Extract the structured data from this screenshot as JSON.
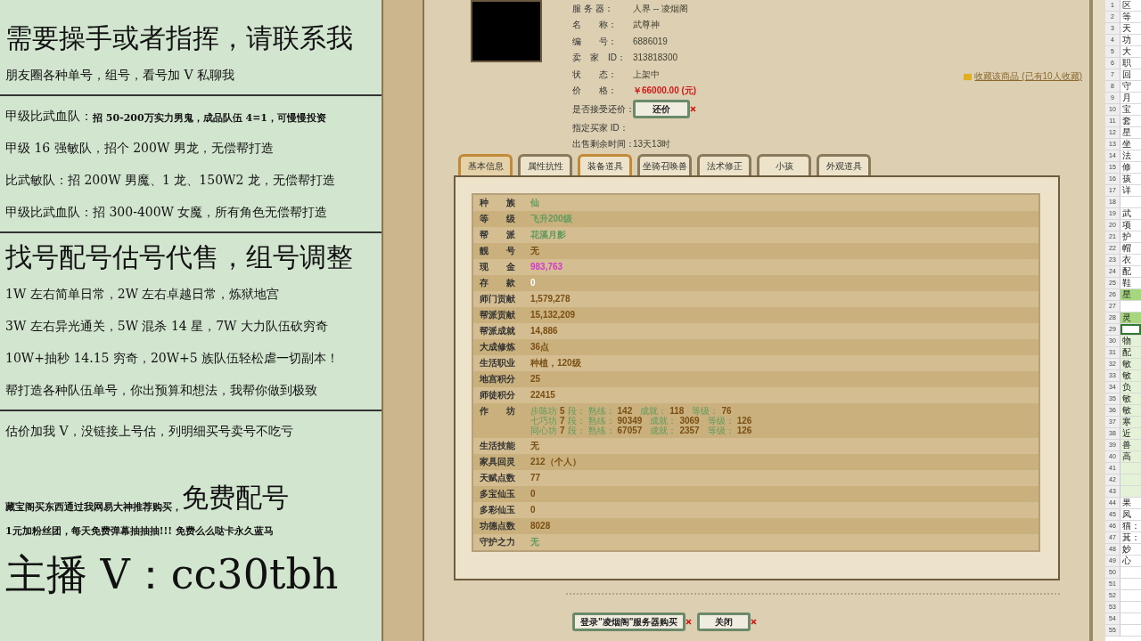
{
  "ad_panel": [
    {
      "kind": "text",
      "parts": [
        {
          "text": "需要操手或者指挥，请联系我",
          "kind": "xl"
        }
      ]
    },
    {
      "kind": "text",
      "parts": [
        {
          "text": "朋友圈各种单号，组号，看号加 V 私聊我",
          "kind": "md"
        }
      ]
    },
    {
      "kind": "divider"
    },
    {
      "kind": "text",
      "parts": [
        {
          "text": "甲级比武血队：",
          "kind": "md"
        },
        {
          "text": "招 50-200万实力男鬼，成品队伍 4=1，可慢慢投资",
          "kind": "sm"
        }
      ]
    },
    {
      "kind": "text",
      "parts": [
        {
          "text": "甲级 16 强敏队，招个 200W 男龙，无偿帮打造",
          "kind": "md"
        }
      ]
    },
    {
      "kind": "text",
      "parts": [
        {
          "text": "比武敏队：招 200W 男魔、1 龙、150W2 龙，无偿帮打造",
          "kind": "md"
        }
      ]
    },
    {
      "kind": "text",
      "parts": [
        {
          "text": "甲级比武血队：招 300-400W 女魔，所有角色无偿帮打造",
          "kind": "md"
        }
      ]
    },
    {
      "kind": "divider"
    },
    {
      "kind": "text",
      "parts": [
        {
          "text": "找号配号估号代售，组号调整",
          "kind": "xl"
        }
      ]
    },
    {
      "kind": "text",
      "parts": [
        {
          "text": "1W 左右简单日常，2W 左右卓越日常，炼狱地宫",
          "kind": "md"
        }
      ]
    },
    {
      "kind": "text",
      "parts": [
        {
          "text": "3W 左右异光通关，5W 混杀 14 星，7W 大力队伍砍穷奇",
          "kind": "md"
        }
      ]
    },
    {
      "kind": "text",
      "parts": [
        {
          "text": "10W+抽秒 14.15 穷奇，20W+5 族队伍轻松虐一切副本！",
          "kind": "md"
        }
      ]
    },
    {
      "kind": "text",
      "parts": [
        {
          "text": "帮打造各种队伍单号，你出预算和想法，我帮你做到极致",
          "kind": "md"
        }
      ]
    },
    {
      "kind": "divider"
    },
    {
      "kind": "text",
      "parts": [
        {
          "text": "估价加我 V，没链接上号估，列明细买号卖号不吃亏",
          "kind": "md"
        }
      ]
    },
    {
      "kind": "spacer"
    },
    {
      "kind": "text",
      "parts": [
        {
          "text": "藏宝阁买东西通过我网易大神推荐购买，",
          "kind": "sm"
        },
        {
          "text": "免费配号",
          "kind": "xl"
        }
      ]
    },
    {
      "kind": "text",
      "parts": [
        {
          "text": "1元加粉丝团，每天免费弹幕抽抽抽!!! 免费么么哒卡永久蓝马",
          "kind": "sm"
        }
      ]
    },
    {
      "kind": "text",
      "parts": [
        {
          "text": "主播 V：cc30tbh",
          "kind": "xxl"
        }
      ]
    }
  ],
  "listing": {
    "favorite_link": "收藏该商品 (已有10人收藏)",
    "info": [
      {
        "label": "服 务 器：",
        "value": "人界 -- 凌烟阁",
        "kind": "text"
      },
      {
        "label": "名　　称：",
        "value": "武尊神",
        "kind": "text"
      },
      {
        "label": "编　　号：",
        "value": "6886019",
        "kind": "text"
      },
      {
        "label": "卖　家　ID：",
        "value": "313818300",
        "kind": "text"
      },
      {
        "label": "状　　态：",
        "value": "上架中",
        "kind": "text"
      },
      {
        "label": "价　　格：",
        "value": "￥66000.00 (元)",
        "kind": "price"
      },
      {
        "label": "是否接受还价：",
        "value": "还价",
        "kind": "button"
      },
      {
        "label": "指定买家 ID：",
        "kind": "text"
      },
      {
        "label": "出售剩余时间：",
        "value": "13天13时",
        "kind": "text"
      }
    ],
    "tabs": [
      {
        "label": "基本信息",
        "selected": true,
        "hovered": false
      },
      {
        "label": "属性抗性",
        "selected": false,
        "hovered": false
      },
      {
        "label": "装备道具",
        "selected": false,
        "hovered": true
      },
      {
        "label": "坐骑召唤兽",
        "selected": false,
        "hovered": false
      },
      {
        "label": "法术修正",
        "selected": false,
        "hovered": false
      },
      {
        "label": "小孩",
        "selected": false,
        "hovered": false
      },
      {
        "label": "外观道具",
        "selected": false,
        "hovered": false
      }
    ],
    "rows": [
      {
        "label": "种　　族",
        "value": "仙",
        "color": "#5f9a5f"
      },
      {
        "label": "等　　级",
        "value": "飞升200级",
        "color": "#5f9a5f"
      },
      {
        "label": "帮　　派",
        "value": "花溪月影",
        "color": "#5f9a5f"
      },
      {
        "label": "靓　　号",
        "value": "无",
        "color": "#7a4f14"
      },
      {
        "label": "现　　金",
        "value": "983,763",
        "color": "#d43ad0"
      },
      {
        "label": "存　　款",
        "value": "0",
        "color": "#ffffff"
      },
      {
        "label": "师门贡献",
        "value": "1,579,278",
        "color": "#7a4f14"
      },
      {
        "label": "帮派贡献",
        "value": "15,132,209",
        "color": "#7a4f14"
      },
      {
        "label": "帮派成就",
        "value": "14,886",
        "color": "#7a4f14"
      },
      {
        "label": "大成修炼",
        "value": "36点",
        "color": "#7a4f14"
      },
      {
        "label": "生活职业",
        "value": "种植，120级",
        "color": "#7a4f14"
      },
      {
        "label": "地宫积分",
        "value": "25",
        "color": "#7a4f14"
      },
      {
        "label": "师徒积分",
        "value": "22415",
        "color": "#7a4f14"
      },
      {
        "label": "作　　坊",
        "workshops": [
          {
            "name": "步陈坊",
            "grade": "5",
            "grade_unit": "段：",
            "stats": [
              {
                "label": "熟练：",
                "value": "142"
              },
              {
                "label": "成就：",
                "value": "118"
              },
              {
                "label": "等级：",
                "value": "76"
              }
            ]
          },
          {
            "name": "七巧坊",
            "grade": "7",
            "grade_unit": "段：",
            "stats": [
              {
                "label": "熟练：",
                "value": "90349"
              },
              {
                "label": "成就：",
                "value": "3069"
              },
              {
                "label": "等级：",
                "value": "126"
              }
            ]
          },
          {
            "name": "同心坊",
            "grade": "7",
            "grade_unit": "段：",
            "stats": [
              {
                "label": "熟练：",
                "value": "67057"
              },
              {
                "label": "成就：",
                "value": "2357"
              },
              {
                "label": "等级：",
                "value": "126"
              }
            ]
          }
        ]
      },
      {
        "label": "生活技能",
        "value": "无",
        "color": "#7a4f14"
      },
      {
        "label": "家具回灵",
        "value": "212（个人）",
        "color": "#7a4f14"
      },
      {
        "label": "天赋点数",
        "value": "77",
        "color": "#7a4f14"
      },
      {
        "label": "多宝仙玉",
        "value": "0",
        "color": "#7a4f14"
      },
      {
        "label": "多彩仙玉",
        "value": "0",
        "color": "#7a4f14"
      },
      {
        "label": "功德点数",
        "value": "8028",
        "color": "#7a4f14"
      },
      {
        "label": "守护之力",
        "value": "无",
        "color": "#5f9a5f"
      }
    ],
    "buttons": [
      "登录\"凌烟阁\"服务器购买",
      "关闭"
    ]
  },
  "sheet": [
    {
      "num": "1",
      "text": "区",
      "selected": false
    },
    {
      "num": "2",
      "text": "等",
      "selected": false
    },
    {
      "num": "3",
      "text": "天",
      "selected": false
    },
    {
      "num": "4",
      "text": "功",
      "selected": false
    },
    {
      "num": "5",
      "text": "大",
      "selected": false
    },
    {
      "num": "6",
      "text": "职",
      "selected": false
    },
    {
      "num": "7",
      "text": "回",
      "selected": false
    },
    {
      "num": "8",
      "text": "守",
      "selected": false
    },
    {
      "num": "9",
      "text": "月",
      "selected": false
    },
    {
      "num": "10",
      "text": "宝",
      "selected": false
    },
    {
      "num": "11",
      "text": "套",
      "selected": false
    },
    {
      "num": "12",
      "text": "星",
      "selected": false
    },
    {
      "num": "13",
      "text": "坐",
      "selected": false
    },
    {
      "num": "14",
      "text": "法",
      "selected": false
    },
    {
      "num": "15",
      "text": "修",
      "selected": false
    },
    {
      "num": "16",
      "text": "孩",
      "selected": false
    },
    {
      "num": "17",
      "text": "详",
      "selected": false
    },
    {
      "num": "18",
      "selected": false
    },
    {
      "num": "19",
      "text": "武",
      "selected": false
    },
    {
      "num": "20",
      "text": "项",
      "selected": false
    },
    {
      "num": "21",
      "text": "护",
      "selected": false
    },
    {
      "num": "22",
      "text": "帽",
      "selected": false
    },
    {
      "num": "23",
      "text": "衣",
      "selected": false
    },
    {
      "num": "24",
      "text": "配",
      "selected": false
    },
    {
      "num": "25",
      "text": "鞋",
      "selected": false
    },
    {
      "num": "26",
      "text": "星",
      "selected": false,
      "color": "#a6d67e"
    },
    {
      "num": "27",
      "selected": false
    },
    {
      "num": "28",
      "text": "灵",
      "selected": false,
      "color": "#a6d67e"
    },
    {
      "num": "29",
      "selected": true
    },
    {
      "num": "30",
      "text": "物",
      "selected": false,
      "color": "#e4f2d8"
    },
    {
      "num": "31",
      "text": "配",
      "selected": false,
      "color": "#e4f2d8"
    },
    {
      "num": "32",
      "text": "敏",
      "selected": false,
      "color": "#e4f2d8"
    },
    {
      "num": "33",
      "text": "敏",
      "selected": false,
      "color": "#e4f2d8"
    },
    {
      "num": "34",
      "text": "负",
      "selected": false,
      "color": "#e4f2d8"
    },
    {
      "num": "35",
      "text": "敏",
      "selected": false,
      "color": "#e4f2d8"
    },
    {
      "num": "36",
      "text": "敏",
      "selected": false,
      "color": "#e4f2d8"
    },
    {
      "num": "37",
      "text": "寒",
      "selected": false,
      "color": "#e4f2d8"
    },
    {
      "num": "38",
      "text": "近",
      "selected": false,
      "color": "#e4f2d8"
    },
    {
      "num": "39",
      "text": "兽",
      "selected": false,
      "color": "#e4f2d8"
    },
    {
      "num": "40",
      "text": "高",
      "selected": false,
      "color": "#e4f2d8"
    },
    {
      "num": "41",
      "selected": false,
      "color": "#e4f2d8"
    },
    {
      "num": "42",
      "selected": false,
      "color": "#e4f2d8"
    },
    {
      "num": "43",
      "selected": false,
      "color": "#e4f2d8"
    },
    {
      "num": "44",
      "text": "果",
      "selected": false
    },
    {
      "num": "45",
      "text": "凤",
      "selected": false
    },
    {
      "num": "46",
      "text": "猫：",
      "selected": false
    },
    {
      "num": "47",
      "text": "萁：",
      "selected": false
    },
    {
      "num": "48",
      "text": "妙",
      "selected": false
    },
    {
      "num": "49",
      "text": "心",
      "selected": false
    },
    {
      "num": "50",
      "selected": false
    },
    {
      "num": "51",
      "selected": false
    },
    {
      "num": "52",
      "selected": false
    },
    {
      "num": "53",
      "selected": false
    },
    {
      "num": "54",
      "selected": false
    },
    {
      "num": "55",
      "selected": false
    }
  ]
}
